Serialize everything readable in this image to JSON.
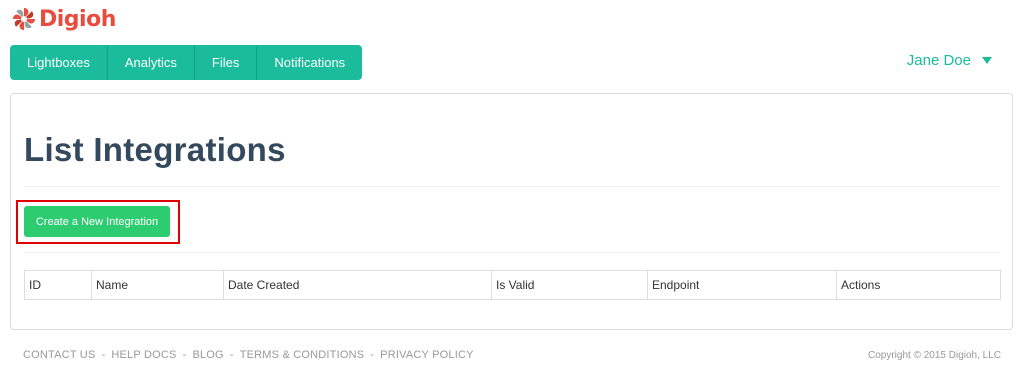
{
  "brand": {
    "name": "Digioh",
    "color": "#e84c3d",
    "logo_icon": "digioh-swirl-icon"
  },
  "nav": {
    "color": "#1abc9c",
    "items": [
      {
        "label": "Lightboxes"
      },
      {
        "label": "Analytics"
      },
      {
        "label": "Files"
      },
      {
        "label": "Notifications"
      }
    ]
  },
  "user": {
    "name": "Jane Doe",
    "icon": "chevron-down-icon"
  },
  "main": {
    "title": "List Integrations",
    "create_button_label": "Create a New Integration",
    "highlight_color": "#e00000",
    "table": {
      "columns": [
        "ID",
        "Name",
        "Date Created",
        "Is Valid",
        "Endpoint",
        "Actions"
      ],
      "rows": []
    }
  },
  "footer": {
    "links": [
      {
        "label": "CONTACT US"
      },
      {
        "label": "HELP DOCS"
      },
      {
        "label": "BLOG"
      },
      {
        "label": "TERMS & CONDITIONS"
      },
      {
        "label": "PRIVACY POLICY"
      }
    ],
    "separator": "-",
    "copyright": "Copyright © 2015 Digioh, LLC"
  }
}
